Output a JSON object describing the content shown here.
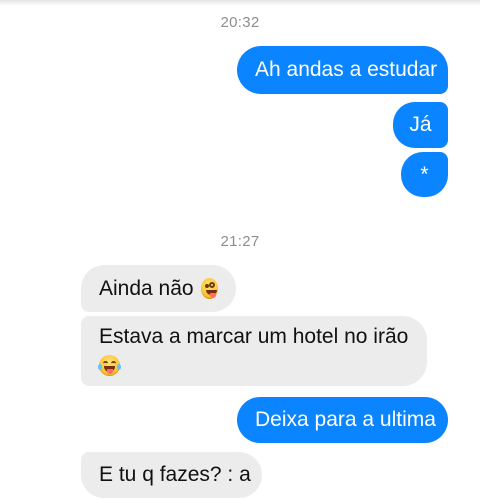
{
  "conversation": {
    "groups": [
      {
        "timestamp": "20:32",
        "messages": [
          {
            "direction": "outgoing",
            "text": "Ah andas a estudar"
          },
          {
            "direction": "outgoing",
            "text": "Já"
          },
          {
            "direction": "outgoing",
            "text": "*"
          }
        ]
      },
      {
        "timestamp": "21:27",
        "messages": [
          {
            "direction": "incoming",
            "text": "Ainda não",
            "emoji": "zany-face-emoji"
          },
          {
            "direction": "incoming",
            "text": "Estava a marcar um hotel no irão",
            "emoji": "laughing-tears-emoji"
          },
          {
            "direction": "outgoing",
            "text": "Deixa para a ultima"
          },
          {
            "direction": "incoming",
            "text": "E tu q fazes? : a"
          }
        ]
      }
    ]
  },
  "colors": {
    "outgoing_bubble": "#0a84ff",
    "outgoing_text": "#ffffff",
    "incoming_bubble": "#ececec",
    "incoming_text": "#111111",
    "timestamp_text": "#8e8e8e"
  }
}
